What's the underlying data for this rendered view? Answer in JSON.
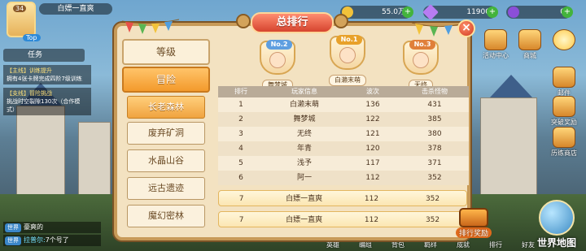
{
  "hud": {
    "level": "34",
    "top_badge": "Top",
    "player_name": "白嫖一直爽",
    "resources": [
      {
        "value": "55.0万",
        "icon": "gold-coin-icon",
        "color": "#f2c23a"
      },
      {
        "value": "11900",
        "icon": "diamond-icon",
        "color": "#b77cf2"
      },
      {
        "value": "0",
        "icon": "purple-gem-icon",
        "color": "#8b4fd8"
      }
    ]
  },
  "quests": {
    "header": "任务",
    "items": [
      {
        "title": "【主线】训练提升",
        "desc": "拥有4张卡牌完成四阶7级训练"
      },
      {
        "title": "【支线】冒险挑战",
        "desc": "挑战时空裂隙130次（合作模式）"
      }
    ]
  },
  "chat": [
    {
      "tag": "世界",
      "who": "",
      "msg": "豪爽的"
    },
    {
      "tag": "世界",
      "who": "拉普尔:",
      "msg": "7个号了"
    }
  ],
  "side_icons": [
    {
      "label": "活动中心",
      "icon": "event-center-icon"
    },
    {
      "label": "商城",
      "icon": "shop-icon"
    },
    {
      "label": "邮件",
      "icon": "mail-icon"
    },
    {
      "label": "突破奖励",
      "icon": "breakthrough-reward-icon"
    },
    {
      "label": "历练商店",
      "icon": "training-shop-icon"
    }
  ],
  "bottom_menu": [
    "英雄",
    "编组",
    "背包",
    "羁绊",
    "成就",
    "排行",
    "好友"
  ],
  "world_map": "世界地图",
  "dialog": {
    "title": "总排行",
    "close": "×",
    "categories": [
      "等级",
      "冒险"
    ],
    "active_category": 1,
    "sub_tabs": [
      "长老森林",
      "废弃矿洞",
      "水晶山谷",
      "远古遗迹",
      "魔幻密林"
    ],
    "active_sub_tab": 0,
    "podium": [
      {
        "rank": "No.2",
        "name": "舞梦城",
        "color": "#5e9ee0"
      },
      {
        "rank": "No.1",
        "name": "白濑末萌",
        "color": "#e8a12a"
      },
      {
        "rank": "No.3",
        "name": "无终",
        "color": "#e07f3a"
      }
    ],
    "table": {
      "headers": [
        "排行",
        "玩家信息",
        "波次",
        "击杀怪物"
      ],
      "rows": [
        [
          "1",
          "白濑末萌",
          "136",
          "431"
        ],
        [
          "2",
          "舞梦城",
          "122",
          "385"
        ],
        [
          "3",
          "无终",
          "121",
          "380"
        ],
        [
          "4",
          "年青",
          "120",
          "378"
        ],
        [
          "5",
          "浅予",
          "117",
          "371"
        ],
        [
          "6",
          "阿一",
          "112",
          "352"
        ]
      ]
    },
    "self_rows": [
      [
        "7",
        "白嫖一直爽",
        "112",
        "352"
      ],
      [
        "7",
        "白嫖一直爽",
        "112",
        "352"
      ]
    ],
    "reward_label": "排行奖励"
  }
}
